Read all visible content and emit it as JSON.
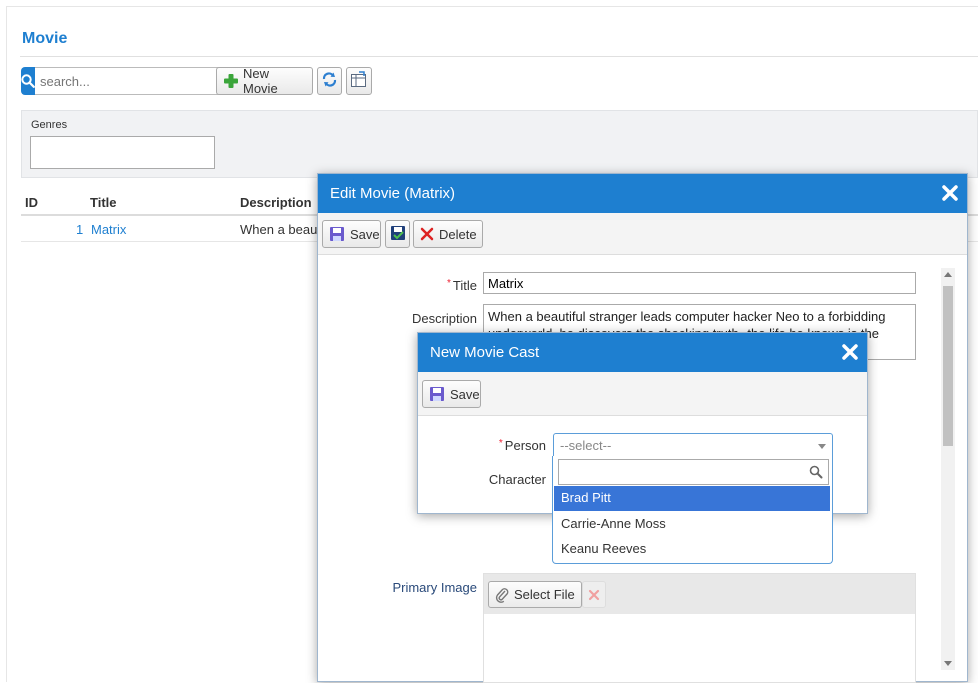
{
  "page": {
    "title": "Movie"
  },
  "toolbar": {
    "search_placeholder": "search...",
    "new_movie_label": "New Movie",
    "refresh_icon": "refresh-icon",
    "export_icon": "column-picker-icon"
  },
  "filters": {
    "genres_label": "Genres",
    "genres_value": ""
  },
  "grid": {
    "columns": [
      "ID",
      "Title",
      "Description"
    ],
    "rows": [
      {
        "id": "1",
        "title": "Matrix",
        "description": "When a beautiful"
      }
    ]
  },
  "edit_dialog": {
    "title": "Edit Movie (Matrix)",
    "save_label": "Save",
    "delete_label": "Delete",
    "fields": {
      "title_label": "Title",
      "title_value": "Matrix",
      "description_label": "Description",
      "description_value": "When a beautiful stranger leads computer hacker Neo to a forbidding underworld, he discovers the shocking truth--the life he knows is the",
      "primary_image_label": "Primary Image",
      "select_file_label": "Select File"
    }
  },
  "cast_dialog": {
    "title": "New Movie Cast",
    "save_label": "Save",
    "person_label": "Person",
    "character_label": "Character",
    "person_placeholder": "--select--",
    "options": [
      "Brad Pitt",
      "Carrie-Anne Moss",
      "Keanu Reeves"
    ],
    "highlighted_option": "Brad Pitt"
  },
  "colors": {
    "accent": "#1e7fd0",
    "highlight": "#3875d7",
    "required": "#e23"
  }
}
